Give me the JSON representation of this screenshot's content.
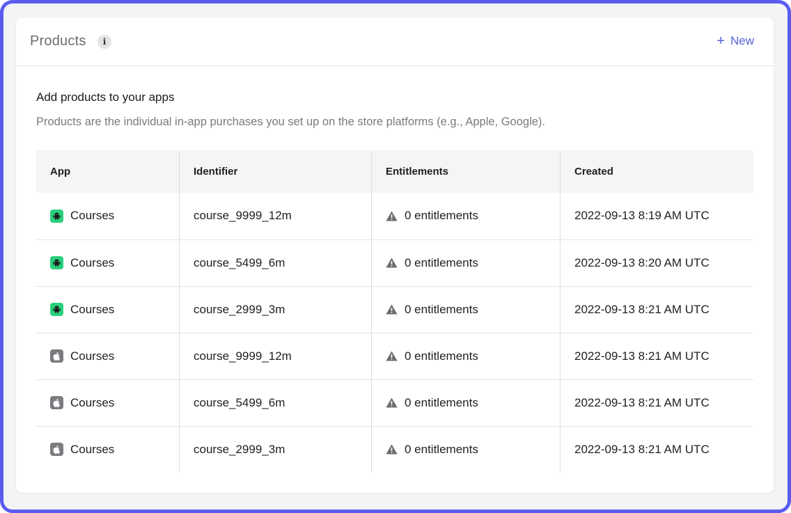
{
  "header": {
    "title": "Products",
    "info_icon": "info-icon",
    "new_label": "New"
  },
  "intro": {
    "heading": "Add products to your apps",
    "description": "Products are the individual in-app purchases you set up on the store platforms (e.g., Apple, Google)."
  },
  "table": {
    "columns": [
      "App",
      "Identifier",
      "Entitlements",
      "Created"
    ],
    "rows": [
      {
        "platform": "android",
        "app": "Courses",
        "identifier": "course_9999_12m",
        "entitlements": "0 entitlements",
        "created": "2022-09-13 8:19 AM UTC"
      },
      {
        "platform": "android",
        "app": "Courses",
        "identifier": "course_5499_6m",
        "entitlements": "0 entitlements",
        "created": "2022-09-13 8:20 AM UTC"
      },
      {
        "platform": "android",
        "app": "Courses",
        "identifier": "course_2999_3m",
        "entitlements": "0 entitlements",
        "created": "2022-09-13 8:21 AM UTC"
      },
      {
        "platform": "apple",
        "app": "Courses",
        "identifier": "course_9999_12m",
        "entitlements": "0 entitlements",
        "created": "2022-09-13 8:21 AM UTC"
      },
      {
        "platform": "apple",
        "app": "Courses",
        "identifier": "course_5499_6m",
        "entitlements": "0 entitlements",
        "created": "2022-09-13 8:21 AM UTC"
      },
      {
        "platform": "apple",
        "app": "Courses",
        "identifier": "course_2999_3m",
        "entitlements": "0 entitlements",
        "created": "2022-09-13 8:21 AM UTC"
      }
    ]
  },
  "colors": {
    "accent": "#5262d8",
    "frame": "#5b5bf0",
    "android": "#2ad07d",
    "apple": "#7b7b80",
    "warning": "#6b6b70"
  }
}
